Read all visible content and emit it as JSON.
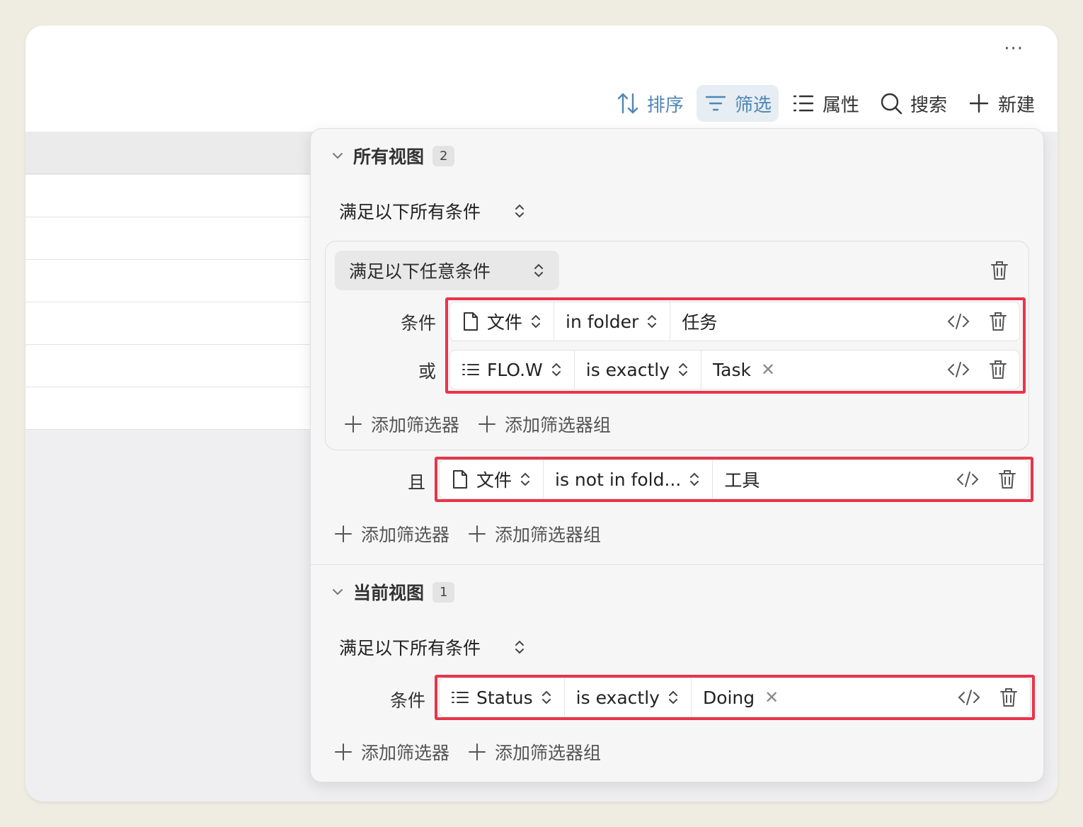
{
  "toolbar": {
    "more": "···",
    "sort": "排序",
    "filter": "筛选",
    "properties": "属性",
    "search": "搜索",
    "new": "新建"
  },
  "all_views": {
    "title": "所有视图",
    "count": "2",
    "match_mode": "满足以下所有条件",
    "group": {
      "match_mode": "满足以下任意条件",
      "filters": [
        {
          "label": "条件",
          "property": "文件",
          "property_icon": "file-icon",
          "operator": "in folder",
          "value": "任务",
          "value_removable": false
        },
        {
          "label": "或",
          "property": "FLO.W",
          "property_icon": "list-icon",
          "operator": "is exactly",
          "value": "Task",
          "value_removable": true
        }
      ],
      "add_filter": "添加筛选器",
      "add_filter_group": "添加筛选器组"
    },
    "filters": [
      {
        "label": "且",
        "property": "文件",
        "property_icon": "file-icon",
        "operator": "is not in fold...",
        "value": "工具",
        "value_removable": false
      }
    ],
    "add_filter": "添加筛选器",
    "add_filter_group": "添加筛选器组"
  },
  "current_view": {
    "title": "当前视图",
    "count": "1",
    "match_mode": "满足以下所有条件",
    "filters": [
      {
        "label": "条件",
        "property": "Status",
        "property_icon": "list-icon",
        "operator": "is exactly",
        "value": "Doing",
        "value_removable": true
      }
    ],
    "add_filter": "添加筛选器",
    "add_filter_group": "添加筛选器组"
  },
  "colors": {
    "accent_blue": "#4f86b6",
    "highlight_red": "#e8344a"
  }
}
